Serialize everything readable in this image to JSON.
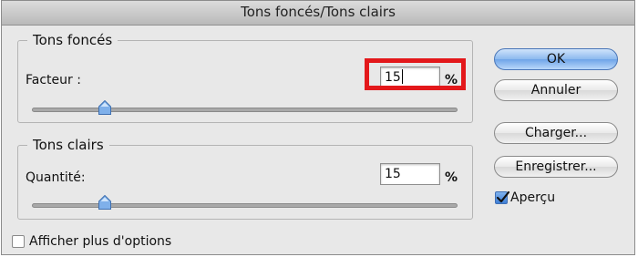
{
  "dialog": {
    "title": "Tons foncés/Tons clairs"
  },
  "shadows": {
    "legend": "Tons foncés",
    "field_label": "Facteur :",
    "value": "15",
    "unit": "%",
    "slider_fraction": 0.15
  },
  "highlights": {
    "legend": "Tons clairs",
    "field_label": "Quantité:",
    "value": "15",
    "unit": "%",
    "slider_fraction": 0.15
  },
  "buttons": {
    "ok": "OK",
    "cancel": "Annuler",
    "load": "Charger...",
    "save": "Enregistrer..."
  },
  "preview": {
    "label": "Aperçu",
    "checked": true
  },
  "more_options": {
    "label": "Afficher plus d'options",
    "checked": false
  },
  "colors": {
    "annotation_highlight": "#e3181b",
    "default_button": "#6ea4e8"
  }
}
